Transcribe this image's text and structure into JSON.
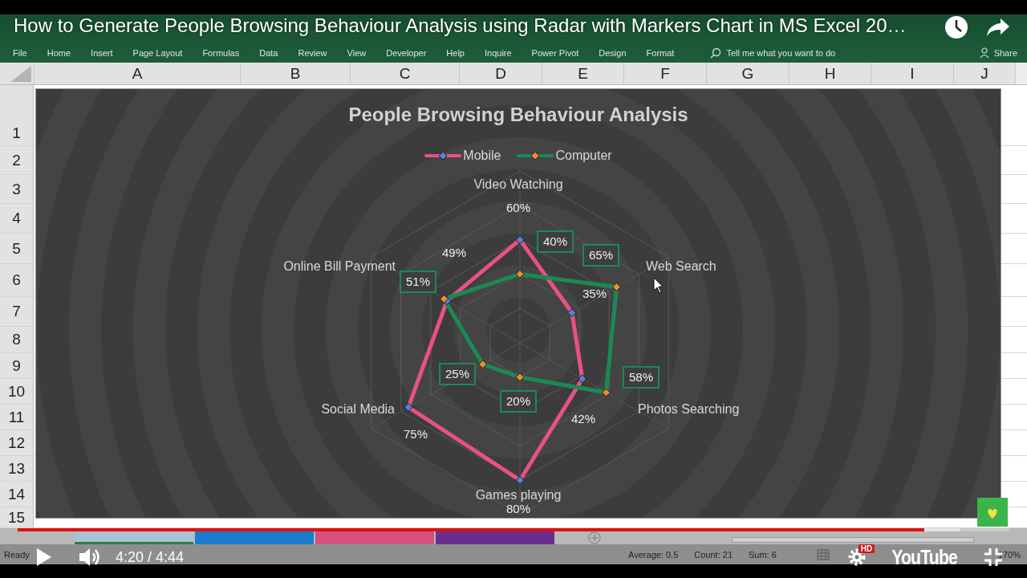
{
  "video": {
    "title": "How to Generate People Browsing Behaviour Analysis using Radar with Markers Chart in MS Excel 20…",
    "progress": {
      "level": 0.914
    },
    "time": "4:20 / 4:44",
    "hd_badge": "HD",
    "logo": "YouTube"
  },
  "excel": {
    "ribbon_tabs": [
      "File",
      "Home",
      "Insert",
      "Page Layout",
      "Formulas",
      "Data",
      "Review",
      "View",
      "Developer",
      "Help",
      "Inquire",
      "Power Pivot",
      "Design",
      "Format"
    ],
    "tell_me": "Tell me what you want to do",
    "share": "Share",
    "columns": [
      "A",
      "B",
      "C",
      "D",
      "E",
      "F",
      "G",
      "H",
      "I",
      "J"
    ],
    "rows": [
      "1",
      "2",
      "3",
      "4",
      "5",
      "6",
      "7",
      "8",
      "9",
      "10",
      "11",
      "12",
      "13",
      "14",
      "15"
    ],
    "chart": {
      "title": "People Browsing Behaviour Analysis",
      "axes": [
        "Video Watching",
        "Web Search",
        "Photos Searching",
        "Games playing",
        "Social Media",
        "Online Bill Payment"
      ],
      "series": [
        {
          "name": "Mobile",
          "color": "#e8508a",
          "labels": [
            "60%",
            "35%",
            "42%",
            "80%",
            "75%",
            "49%"
          ]
        },
        {
          "name": "Computer",
          "color": "#1a8a55",
          "labels": [
            "40%",
            "65%",
            "58%",
            "20%",
            "25%",
            "51%"
          ]
        }
      ]
    },
    "sheet_tabs": [
      {
        "color": "#a9c3d6",
        "selected": true
      },
      {
        "color": "#1a7ccc",
        "selected": false
      },
      {
        "color": "#d4507e",
        "selected": false
      },
      {
        "color": "#6a2e8e",
        "selected": false
      }
    ],
    "status": {
      "ready": "Ready",
      "average": "Average: 0.5",
      "count": "Count: 21",
      "sum": "Sum: 6",
      "zoom": "170%"
    }
  }
}
